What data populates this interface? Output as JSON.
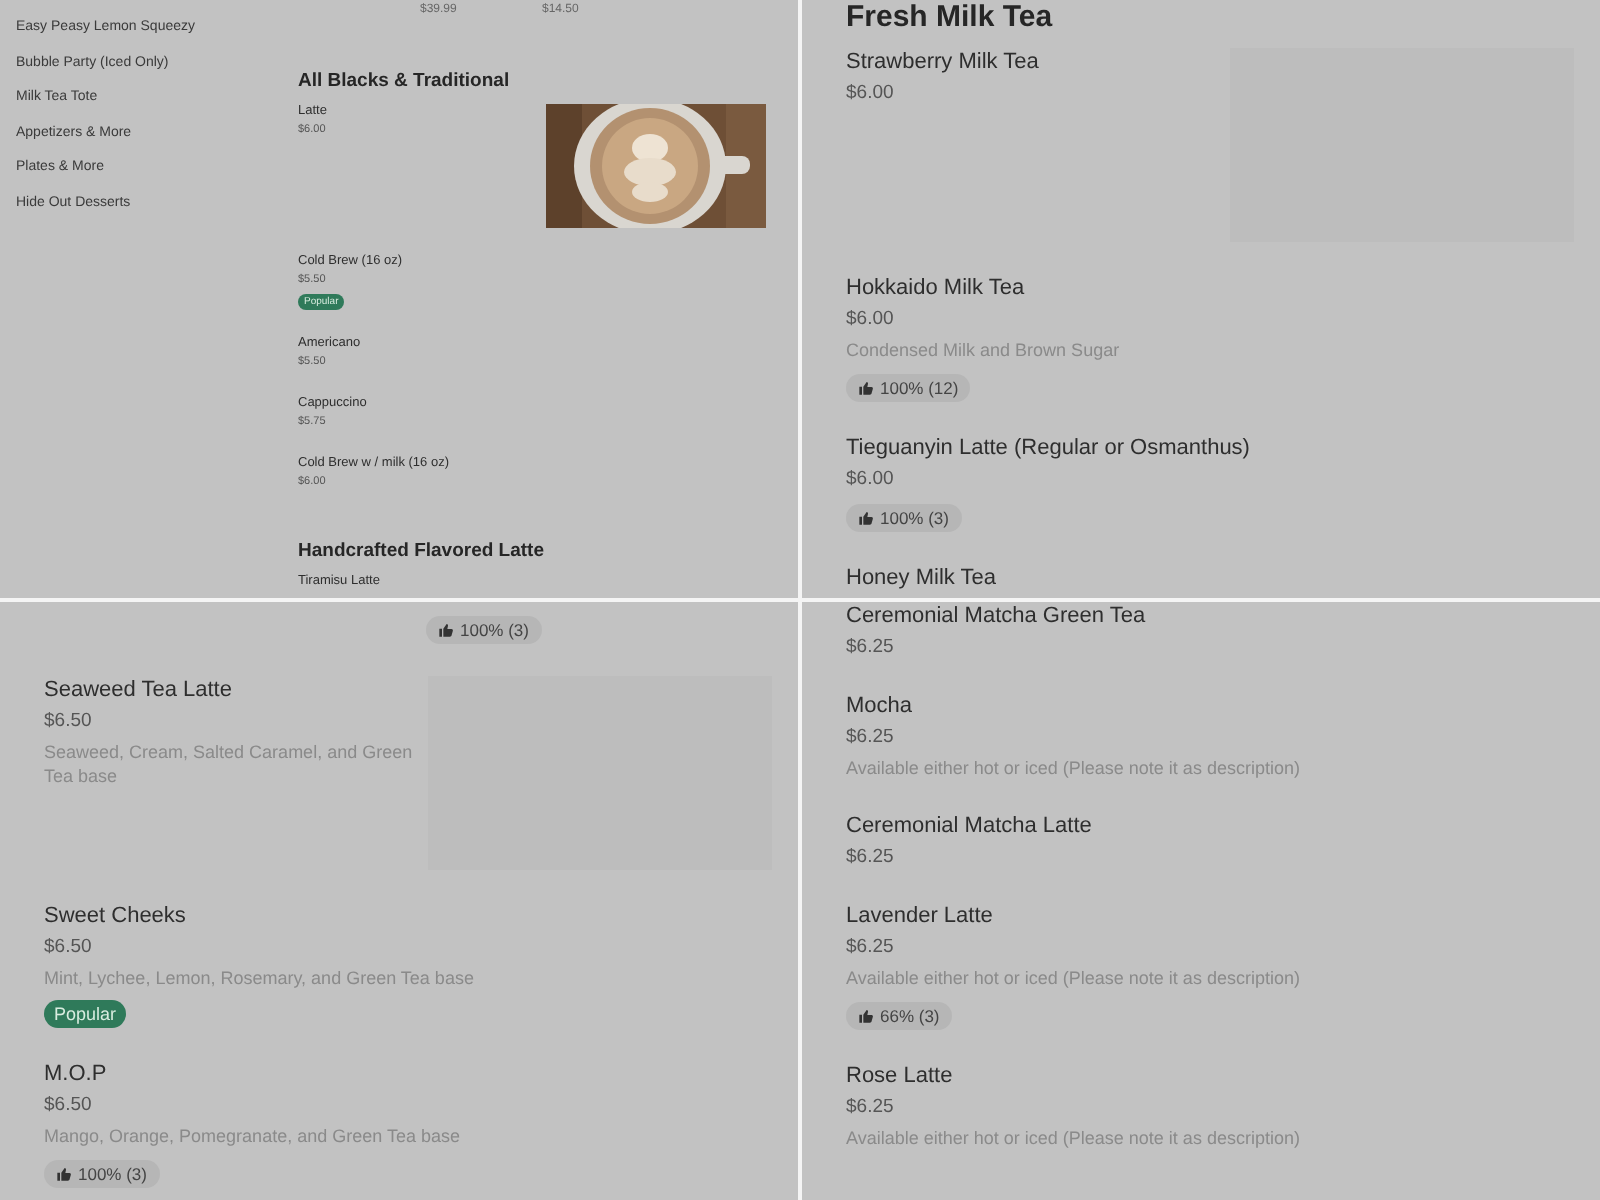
{
  "panels": [
    {
      "kind": "with_sidebar",
      "sidebar": [
        "Easy Peasy Lemon Squeezy",
        "Bubble Party (Iced Only)",
        "Milk Tea Tote",
        "Appetizers & More",
        "Plates & More",
        "Hide Out Desserts"
      ],
      "blocks": [
        {
          "kind": "prices",
          "prices": [
            "$39.99",
            "$14.50"
          ]
        },
        {
          "kind": "heading",
          "text": "All Blacks & Traditional"
        },
        {
          "kind": "photo_item",
          "name": "Latte",
          "price": "$6.00"
        },
        {
          "kind": "item",
          "name": "Cold Brew (16 oz)",
          "price": "$5.50",
          "badge": "Popular"
        },
        {
          "kind": "item",
          "name": "Americano",
          "price": "$5.50"
        },
        {
          "kind": "item",
          "name": "Cappuccino",
          "price": "$5.75"
        },
        {
          "kind": "item",
          "name": "Cold Brew w / milk (16 oz)",
          "price": "$6.00"
        },
        {
          "kind": "heading",
          "text": "Handcrafted Flavored Latte"
        },
        {
          "kind": "item",
          "name": "Tiramisu Latte"
        }
      ]
    },
    {
      "kind": "plain",
      "blocks": [
        {
          "kind": "heading",
          "text": "Fresh Milk Tea"
        },
        {
          "kind": "placeholder_item",
          "name": "Strawberry Milk Tea",
          "price": "$6.00"
        },
        {
          "kind": "item",
          "name": "Hokkaido Milk Tea",
          "price": "$6.00",
          "description": "Condensed Milk and Brown Sugar",
          "rating": "100% (12)"
        },
        {
          "kind": "item",
          "name": "Tieguanyin Latte (Regular or Osmanthus)",
          "price": "$6.00",
          "rating": "100% (3)"
        },
        {
          "kind": "item",
          "name": "Honey Milk Tea"
        }
      ]
    },
    {
      "kind": "plain",
      "blocks": [
        {
          "kind": "side_rating",
          "rating": "100% (3)"
        },
        {
          "kind": "placeholder_item",
          "name": "Seaweed Tea Latte",
          "price": "$6.50",
          "description": "Seaweed, Cream, Salted Caramel, and Green Tea base"
        },
        {
          "kind": "item",
          "name": "Sweet Cheeks",
          "price": "$6.50",
          "description": "Mint, Lychee, Lemon, Rosemary, and Green Tea base",
          "badge": "Popular"
        },
        {
          "kind": "item",
          "name": "M.O.P",
          "price": "$6.50",
          "description": "Mango, Orange, Pomegranate, and Green Tea base",
          "rating": "100% (3)"
        }
      ]
    },
    {
      "kind": "plain",
      "blocks": [
        {
          "kind": "item",
          "name": "Ceremonial Matcha Green Tea",
          "price": "$6.25"
        },
        {
          "kind": "item",
          "name": "Mocha",
          "price": "$6.25",
          "description": "Available either hot or iced (Please note it as description)"
        },
        {
          "kind": "item",
          "name": "Ceremonial Matcha Latte",
          "price": "$6.25"
        },
        {
          "kind": "item",
          "name": "Lavender Latte",
          "price": "$6.25",
          "description": "Available either hot or iced (Please note it as description)",
          "rating": "66% (3)"
        },
        {
          "kind": "item",
          "name": "Rose Latte",
          "price": "$6.25",
          "description": "Available either hot or iced (Please note it as description)"
        }
      ]
    }
  ]
}
